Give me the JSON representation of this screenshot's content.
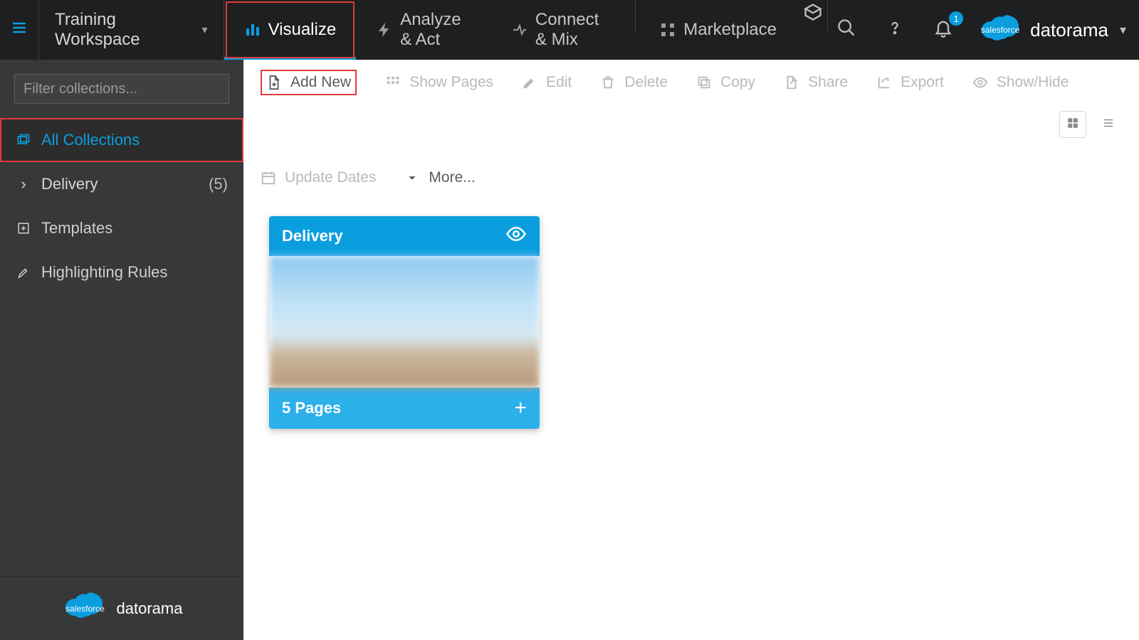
{
  "header": {
    "workspace": "Training Workspace",
    "tabs": {
      "visualize": "Visualize",
      "analyze": "Analyze & Act",
      "connect": "Connect & Mix",
      "marketplace": "Marketplace"
    },
    "notification_count": "1",
    "brand_product": "datorama",
    "brand_company": "salesforce"
  },
  "sidebar": {
    "filter_placeholder": "Filter collections...",
    "all_collections": "All Collections",
    "collections": [
      {
        "name": "Delivery",
        "count": "(5)"
      }
    ],
    "templates": "Templates",
    "highlighting": "Highlighting Rules",
    "footer_brand": "datorama",
    "footer_company": "salesforce"
  },
  "toolbar": {
    "add_new": "Add New",
    "show_pages": "Show Pages",
    "edit": "Edit",
    "delete": "Delete",
    "copy": "Copy",
    "share": "Share",
    "export": "Export",
    "show_hide": "Show/Hide",
    "update_dates": "Update Dates",
    "more": "More..."
  },
  "cards": [
    {
      "title": "Delivery",
      "pages": "5 Pages"
    }
  ]
}
